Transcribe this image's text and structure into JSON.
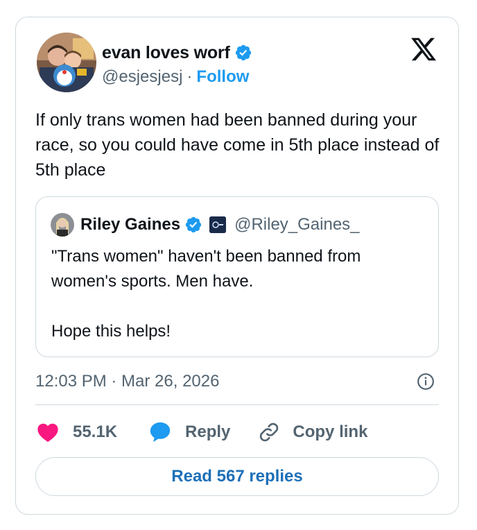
{
  "tweet": {
    "author": {
      "display_name": "evan loves worf",
      "handle": "@esjesjesj",
      "separator": "·",
      "follow_label": "Follow"
    },
    "text": "If only trans women had been banned during your race, so you could have come in 5th place instead of 5th place",
    "timestamp": "12:03 PM · Mar 26, 2026"
  },
  "quote": {
    "display_name": "Riley Gaines",
    "handle": "@Riley_Gaines_",
    "text": "\"Trans women\" haven't been banned from women's sports. Men have.\n\nHope this helps!"
  },
  "actions": {
    "likes": "55.1K",
    "reply_label": "Reply",
    "copy_label": "Copy link",
    "read_replies_label": "Read 567 replies"
  },
  "icons": {
    "verified": "verified-badge-icon",
    "logo": "x-logo-icon",
    "info": "info-icon",
    "like": "heart-icon",
    "reply": "speech-bubble-icon",
    "copy": "link-icon"
  },
  "colors": {
    "accent": "#1d9bf0",
    "like": "#f91880",
    "text": "#0f1419",
    "muted": "#536471",
    "border": "#cfd9de",
    "read_button_text": "#1d70b8"
  }
}
